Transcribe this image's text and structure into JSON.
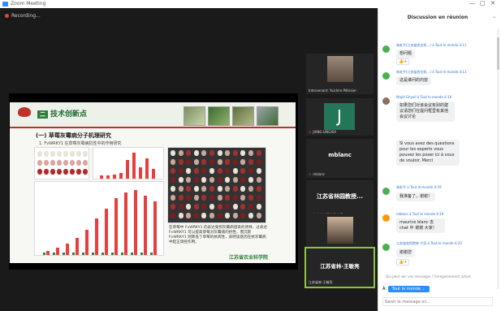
{
  "window": {
    "title": "Zoom Meeting",
    "controls": [
      "—",
      "□",
      "✕"
    ]
  },
  "recording": {
    "label": "Recording..."
  },
  "slide": {
    "section_tag": "二",
    "section_title": "技术创新点",
    "subtitle": "(一)  草莓灰霉病分子机理研究",
    "figure_caption": "1. FvWRKY1 在草莓灰霉病抗性中的作用研究",
    "body_text": "在草莓中 FvWRKY1 的表达受到灰霉病侵染的诱导，过表达 FvWRKY1 可以提高草莓对灰霉病的抗性，而沉默 FvWRKY1 则降低了草莓的抗病性，表明该基因在抗灰霉病中起正调控作用。",
    "footer_logo": "江苏省农业科学院",
    "chart_top_values": [
      1.0,
      1.2,
      1.5,
      2.0,
      6.5,
      9.0,
      4.0,
      7.0,
      3.5
    ],
    "chart_bottom_values": [
      0.3,
      0.5,
      0.8,
      1.2,
      1.8,
      2.6,
      3.3,
      4.0,
      4.4,
      4.6,
      4.2,
      3.8
    ],
    "colors": {
      "accent_green": "#2e7d3a",
      "accent_red": "#b5372b",
      "bar_red": "#e83e3e"
    }
  },
  "participants": [
    {
      "name": "Intervenant: Yuichiro Pélissier"
    },
    {
      "initial": "J",
      "name": "JIANG LINGXIA"
    },
    {
      "big_name": "mblanc",
      "name": "mblanc"
    },
    {
      "big_name": "江苏省林园教授...",
      "name": "江苏省林园教授-宁冠"
    },
    {
      "name": "Majid Ghyoli"
    },
    {
      "big_name": "江苏省林-王敏亮",
      "name": "江苏省林-王敏亮"
    }
  ],
  "chat": {
    "title": "Discussion en réunion",
    "close": "⌄",
    "messages": [
      {
        "meta": "朱虹平(江苏省农业科...) à Tout le monde 4:11",
        "text": "想问题",
        "avatar_color": "#4caf50",
        "reactions": [
          "👍",
          "+"
        ]
      },
      {
        "meta": "朱虹平(江苏省农业科...) à Tout le monde 4:13",
        "text": "这是谁问的内容",
        "avatar_color": "#4caf50"
      },
      {
        "meta": "Majid Ghyoli à Tout le monde 4:16",
        "text": "如果您们对该会议有别的建议请您们在提问框里有其他会议讨论",
        "avatar_color": "#8d6e63"
      },
      {
        "meta": "",
        "text": "Si vous avez des questions pour les experts vous pouvez les poser ici à vous de vouloir. Merci",
        "avatar_color": ""
      },
      {
        "meta": "朱虹平 à Tout le monde 4:19",
        "text": "我准备了，谢谢！",
        "avatar_color": "#4caf50"
      },
      {
        "meta": "mblanc à Tout le monde 4:19",
        "text": "maurice blanc 去chat 中 谢谢 大家！",
        "avatar_color": "#ff9800"
      },
      {
        "meta": "江苏省农科院林 宁冠 à Tout le monde 4:20",
        "text": "谢谢您",
        "avatar_color": "#4caf50",
        "reactions": [
          "👍",
          "+"
        ]
      }
    ],
    "notice": "Qui peut voir vos messages ? Enregistrement activé",
    "to_label": "À:",
    "to_value": "Tout le monde ⌄",
    "input_placeholder": "Saisir le message ici..."
  }
}
